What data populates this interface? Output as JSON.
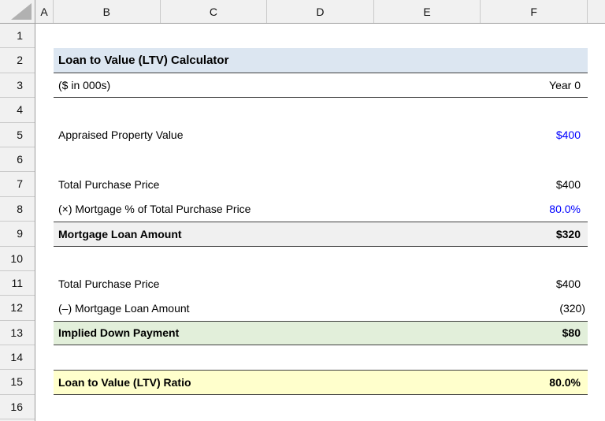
{
  "grid": {
    "column_headers": [
      "A",
      "B",
      "C",
      "D",
      "E",
      "F"
    ],
    "row_headers": [
      "1",
      "2",
      "3",
      "4",
      "5",
      "6",
      "7",
      "8",
      "9",
      "10",
      "11",
      "12",
      "13",
      "14",
      "15",
      "16"
    ]
  },
  "content": {
    "title": "Loan to Value (LTV) Calculator",
    "units_note": "($ in 000s)",
    "period_header": "Year 0",
    "line_items": {
      "appraised_value": {
        "label": "Appraised Property Value",
        "value": "$400"
      },
      "purchase_price_1": {
        "label": "Total Purchase Price",
        "value": "$400"
      },
      "mortgage_pct": {
        "label": "(×) Mortgage % of Total Purchase Price",
        "value": "80.0%"
      },
      "mortgage_loan": {
        "label": "Mortgage Loan Amount",
        "value": "$320"
      },
      "purchase_price_2": {
        "label": "Total Purchase Price",
        "value": "$400"
      },
      "less_mortgage": {
        "label": "(–) Mortgage Loan Amount",
        "value": "(320)"
      },
      "down_payment": {
        "label": "Implied Down Payment",
        "value": "$80"
      },
      "ltv_ratio": {
        "label": "Loan to Value (LTV) Ratio",
        "value": "80.0%"
      }
    }
  },
  "colors": {
    "input_blue": "#0000ff",
    "title_band": "#dce6f1",
    "subtotal_band": "#f0f0f0",
    "down_payment_band": "#e2efda",
    "ltv_band": "#ffffcc",
    "border_dark": "#3f3f3f",
    "header_bg": "#f1f1f1"
  }
}
